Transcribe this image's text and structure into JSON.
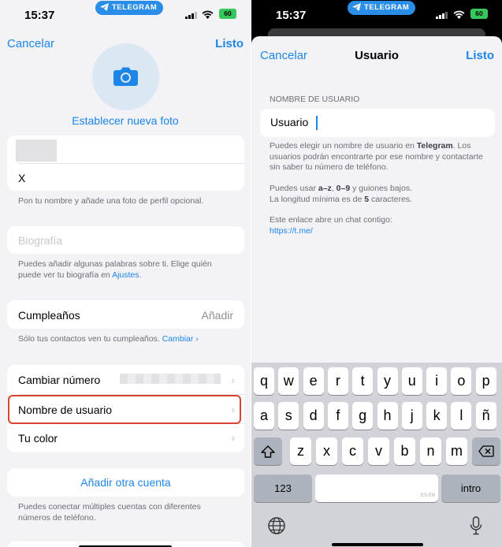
{
  "status_bar": {
    "time": "15:37",
    "pill_label": "TELEGRAM",
    "battery": "60"
  },
  "left": {
    "cancel": "Cancelar",
    "done": "Listo",
    "set_photo": "Establecer nueva foto",
    "last_name": "X",
    "name_hint": "Pon tu nombre y añade una foto de perfil opcional.",
    "bio_placeholder": "Biografía",
    "bio_hint_text": "Puedes añadir algunas palabras sobre ti. Elige quién puede ver tu biografía en ",
    "bio_hint_link": "Ajustes",
    "bio_hint_end": ".",
    "birthday_label": "Cumpleaños",
    "birthday_value": "Añadir",
    "birthday_hint": "Sólo tus contactos ven tu cumpleaños. ",
    "birthday_hint_link": "Cambiar ›",
    "change_number": "Cambiar número",
    "username": "Nombre de usuario",
    "your_color": "Tu color",
    "add_account": "Añadir otra cuenta",
    "add_account_hint": "Puedes conectar múltiples cuentas con diferentes números de teléfono."
  },
  "right": {
    "cancel": "Cancelar",
    "title": "Usuario",
    "done": "Listo",
    "section_header": "NOMBRE DE USUARIO",
    "input_value": "Usuario",
    "hint1_a": "Puedes elegir un nombre de usuario en ",
    "hint1_b": "Telegram",
    "hint1_c": ". Los usuarios podrán encontrarte por ese nombre y contactarte sin saber tu número de teléfono.",
    "hint2_a": "Puedes usar ",
    "hint2_b": "a–z",
    "hint2_c": ", ",
    "hint2_d": "0–9",
    "hint2_e": " y guiones bajos.",
    "hint2_f": "La longitud mínima es de ",
    "hint2_g": "5",
    "hint2_h": " caracteres.",
    "hint3": "Este enlace abre un chat contigo:",
    "link": "https://t.me/"
  },
  "keyboard": {
    "row1": [
      "q",
      "w",
      "e",
      "r",
      "t",
      "y",
      "u",
      "i",
      "o",
      "p"
    ],
    "row2": [
      "a",
      "s",
      "d",
      "f",
      "g",
      "h",
      "j",
      "k",
      "l",
      "ñ"
    ],
    "row3": [
      "z",
      "x",
      "c",
      "v",
      "b",
      "n",
      "m"
    ],
    "numbers_key": "123",
    "space_lang": "ES EN",
    "return_key": "intro"
  },
  "colors": {
    "accent": "#1d86e6",
    "highlight": "#d9432f",
    "keyboard_bg": "#d1d3d9"
  }
}
